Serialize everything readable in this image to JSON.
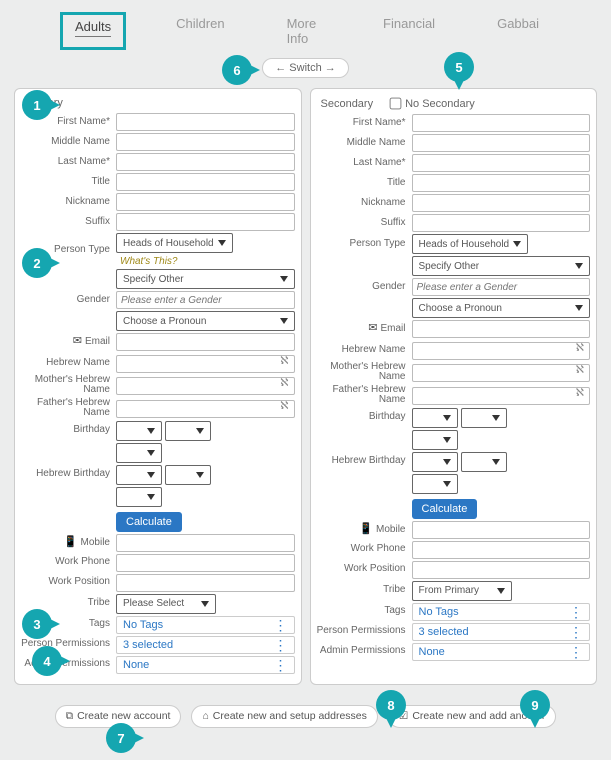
{
  "tabs": {
    "adults": "Adults",
    "children": "Children",
    "more_info": "More Info",
    "financial": "Financial",
    "gabbai": "Gabbai"
  },
  "switch": "Switch",
  "primary": {
    "title": "Primary",
    "labels": {
      "first_name": "First Name*",
      "middle_name": "Middle Name",
      "last_name": "Last Name*",
      "title": "Title",
      "nickname": "Nickname",
      "suffix": "Suffix",
      "person_type": "Person Type",
      "gender": "Gender",
      "email": "Email",
      "heb_name": "Hebrew Name",
      "mother_heb": "Mother's Hebrew Name",
      "father_heb": "Father's Hebrew Name",
      "birthday": "Birthday",
      "heb_birthday": "Hebrew Birthday",
      "mobile": "Mobile",
      "work_phone": "Work Phone",
      "work_pos": "Work Position",
      "tribe": "Tribe",
      "tags": "Tags",
      "person_perm": "Person Permissions",
      "admin_perm": "Admin Permissions"
    },
    "values": {
      "person_type": "Heads of Household",
      "person_type_hint": "What's This?",
      "specify_other": "Specify Other",
      "gender_ph": "Please enter a Gender",
      "pronoun": "Choose a Pronoun",
      "calculate": "Calculate",
      "tribe": "Please Select",
      "tags": "No Tags",
      "person_perm": "3 selected",
      "admin_perm": "None"
    }
  },
  "secondary": {
    "title": "Secondary",
    "no_sec": "No Secondary",
    "labels": {
      "first_name": "First Name*",
      "middle_name": "Middle Name",
      "last_name": "Last Name*",
      "title": "Title",
      "nickname": "Nickname",
      "suffix": "Suffix",
      "person_type": "Person Type",
      "gender": "Gender",
      "email": "Email",
      "heb_name": "Hebrew Name",
      "mother_heb": "Mother's Hebrew Name",
      "father_heb": "Father's Hebrew Name",
      "birthday": "Birthday",
      "heb_birthday": "Hebrew Birthday",
      "mobile": "Mobile",
      "work_phone": "Work Phone",
      "work_pos": "Work Position",
      "tribe": "Tribe",
      "tags": "Tags",
      "person_perm": "Person Permissions",
      "admin_perm": "Admin Permissions"
    },
    "values": {
      "person_type": "Heads of Household",
      "specify_other": "Specify Other",
      "gender_ph": "Please enter a Gender",
      "pronoun": "Choose a Pronoun",
      "calculate": "Calculate",
      "tribe": "From Primary",
      "tags": "No Tags",
      "person_perm": "3 selected",
      "admin_perm": "None"
    }
  },
  "actions": {
    "create": "Create new account",
    "create_addr": "Create new and setup addresses",
    "create_another": "Create new and add another"
  },
  "markers": {
    "m1": "1",
    "m2": "2",
    "m3": "3",
    "m4": "4",
    "m5": "5",
    "m6": "6",
    "m7": "7",
    "m8": "8",
    "m9": "9"
  }
}
